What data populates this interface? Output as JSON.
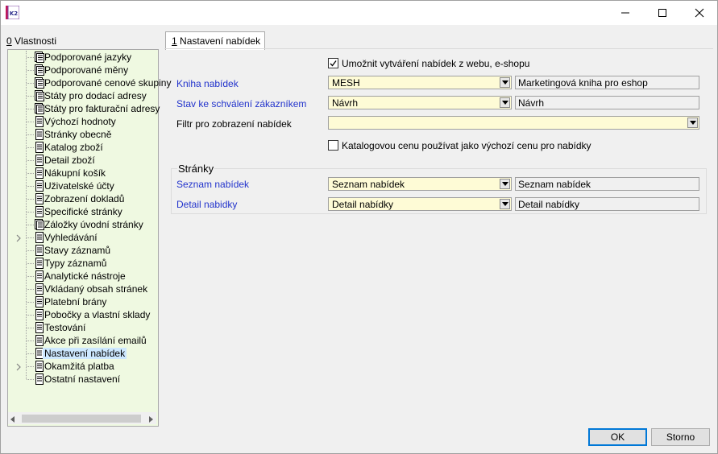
{
  "window": {
    "app_icon": "k2-logo-icon",
    "logo_text": "K2",
    "minimize_icon": "minimize-icon",
    "maximize_icon": "maximize-icon",
    "close_icon": "close-icon"
  },
  "left_panel": {
    "title_prefix": "0",
    "title": " Vlastnosti",
    "items": [
      {
        "label": "Podporované jazyky",
        "icon": "document-list-icon",
        "expandable": false
      },
      {
        "label": "Podporované měny",
        "icon": "document-list-icon",
        "expandable": false
      },
      {
        "label": "Podporované cenové skupiny",
        "icon": "document-list-icon",
        "expandable": false
      },
      {
        "label": "Státy pro dodací adresy",
        "icon": "document-list-icon",
        "expandable": false
      },
      {
        "label": "Státy pro fakturační adresy",
        "icon": "document-list-icon",
        "expandable": false
      },
      {
        "label": "Výchozí hodnoty",
        "icon": "document-icon",
        "expandable": false
      },
      {
        "label": "Stránky obecně",
        "icon": "document-icon",
        "expandable": false
      },
      {
        "label": "Katalog zboží",
        "icon": "document-icon",
        "expandable": false
      },
      {
        "label": "Detail zboží",
        "icon": "document-icon",
        "expandable": false
      },
      {
        "label": "Nákupní košík",
        "icon": "document-icon",
        "expandable": false
      },
      {
        "label": "Uživatelské účty",
        "icon": "document-icon",
        "expandable": false
      },
      {
        "label": "Zobrazení dokladů",
        "icon": "document-icon",
        "expandable": false
      },
      {
        "label": "Specifické stránky",
        "icon": "document-icon",
        "expandable": false
      },
      {
        "label": "Záložky úvodní stránky",
        "icon": "document-list-icon",
        "expandable": false
      },
      {
        "label": "Vyhledávání",
        "icon": "document-icon",
        "expandable": true
      },
      {
        "label": "Stavy záznamů",
        "icon": "document-icon",
        "expandable": false
      },
      {
        "label": "Typy záznamů",
        "icon": "document-icon",
        "expandable": false
      },
      {
        "label": "Analytické nástroje",
        "icon": "document-icon",
        "expandable": false
      },
      {
        "label": "Vkládaný obsah stránek",
        "icon": "document-icon",
        "expandable": false
      },
      {
        "label": "Platební brány",
        "icon": "document-icon",
        "expandable": false
      },
      {
        "label": "Pobočky a vlastní sklady",
        "icon": "document-icon",
        "expandable": false
      },
      {
        "label": "Testování",
        "icon": "document-icon",
        "expandable": false
      },
      {
        "label": "Akce při zasílání emailů",
        "icon": "document-icon",
        "expandable": false
      },
      {
        "label": "Nastavení nabídek",
        "icon": "document-icon",
        "expandable": false,
        "selected": true
      },
      {
        "label": "Okamžitá platba",
        "icon": "document-icon",
        "expandable": true
      },
      {
        "label": "Ostatní nastavení",
        "icon": "document-icon",
        "expandable": false
      }
    ]
  },
  "tab": {
    "prefix": "1",
    "label": " Nastavení nabídek"
  },
  "form": {
    "allow_offers": {
      "label": "Umožnit vytváření nabídek z webu, e-shopu",
      "checked": true
    },
    "offer_book": {
      "label": "Kniha nabídek",
      "value": "MESH",
      "description": "Marketingová kniha pro eshop"
    },
    "approval_state": {
      "label": "Stav ke schválení zákazníkem",
      "value": "Návrh",
      "description": "Návrh"
    },
    "filter": {
      "label": "Filtr pro zobrazení nabídek",
      "value": ""
    },
    "catalog_price": {
      "label": "Katalogovou cenu používat jako výchozí cenu pro nabídky",
      "checked": false
    },
    "pages_group": {
      "title": "Stránky",
      "offer_list": {
        "label": "Seznam nabídek",
        "value": "Seznam nabídek",
        "description": "Seznam nabídek"
      },
      "offer_detail": {
        "label": "Detail nabidky",
        "value": "Detail nabídky",
        "description": "Detail nabídky"
      }
    }
  },
  "buttons": {
    "ok": "OK",
    "cancel": "Storno"
  },
  "colors": {
    "tree_bg": "#eff9e1",
    "combo_bg": "#fefbd6",
    "link_label": "#2233cc",
    "selection": "#cde8ff",
    "ok_border": "#0078d7"
  }
}
